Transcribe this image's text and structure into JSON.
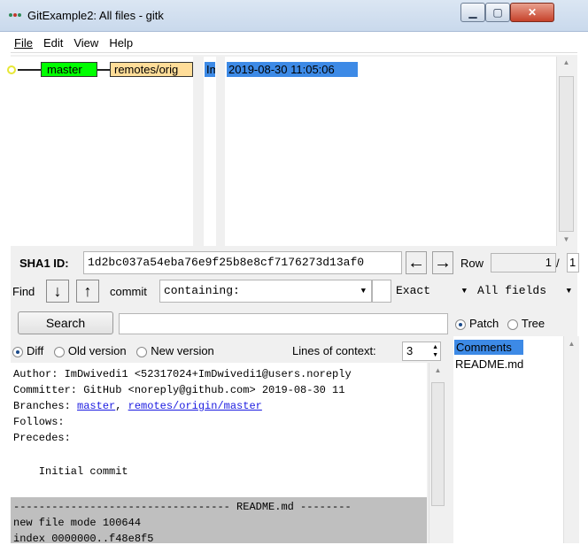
{
  "window": {
    "title": "GitExample2: All files - gitk"
  },
  "menu": [
    "File",
    "Edit",
    "View",
    "Help"
  ],
  "commit_list": {
    "branch_tag": "master",
    "remote_tag": "remotes/orig",
    "author": "Im",
    "date": "2019-08-30 11:05:06"
  },
  "sha": {
    "label": "SHA1 ID:",
    "value": "1d2bc037a54eba76e9f25b8e8cf7176273d13af0",
    "row_label": "Row",
    "row_value": "1",
    "row_sep": "/",
    "row_total": "1"
  },
  "find": {
    "label": "Find",
    "commit_label": "commit",
    "containing": "containing:",
    "exact": "Exact",
    "fields": "All fields"
  },
  "search": {
    "button": "Search",
    "patch": "Patch",
    "tree": "Tree"
  },
  "diff_options": {
    "diff": "Diff",
    "old_version": "Old version",
    "new_version": "New version",
    "context_label": "Lines of context:",
    "context_value": "3"
  },
  "diff_text": {
    "author": "Author: ImDwivedi1 <52317024+ImDwivedi1@users.noreply",
    "committer": "Committer: GitHub <noreply@github.com>  2019-08-30 11",
    "branches_prefix": "Branches: ",
    "branch_1": "master",
    "branch_sep": ", ",
    "branch_2": "remotes/origin/master",
    "follows": "Follows:",
    "precedes": "Precedes:",
    "message": "    Initial commit",
    "file_header": "---------------------------------- README.md --------",
    "file_mode": "new file mode 100644",
    "index_partial": "index 0000000..f48e8f5"
  },
  "files": {
    "selected": "Comments",
    "items": [
      "README.md"
    ]
  }
}
